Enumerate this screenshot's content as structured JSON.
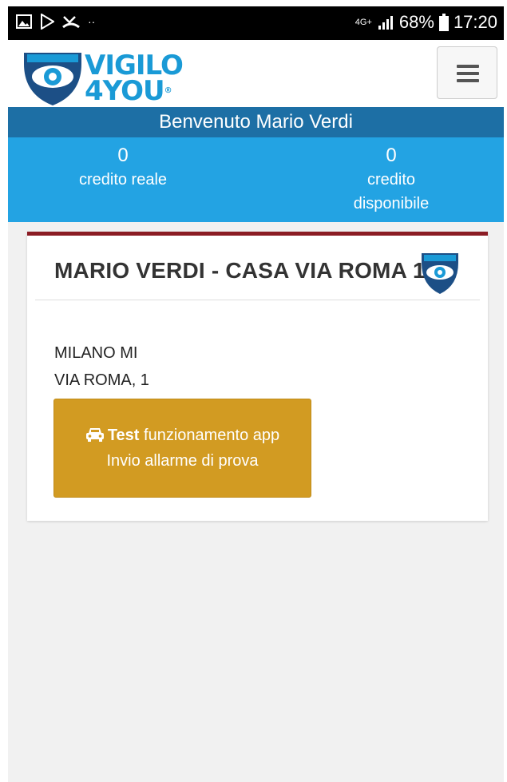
{
  "status_bar": {
    "network": "4G+",
    "battery": "68%",
    "time": "17:20"
  },
  "header": {
    "logo_line1": "VIGILO",
    "logo_line2": "4YOU",
    "logo_registered": "®",
    "menu_icon": "hamburger-icon"
  },
  "welcome": {
    "text": "Benvenuto Mario Verdi"
  },
  "credits": {
    "real": {
      "value": "0",
      "label": "credito reale"
    },
    "available": {
      "value": "0",
      "label_line1": "credito",
      "label_line2": "disponibile"
    }
  },
  "card": {
    "title": "MARIO VERDI - CASA VIA ROMA 1",
    "city": "MILANO MI",
    "street": "VIA ROMA, 1",
    "test_button": {
      "icon": "car-icon",
      "bold": "Test",
      "text": " funzionamento app",
      "subtext": "Invio allarme di prova"
    }
  },
  "colors": {
    "brand_blue": "#1a9ad6",
    "welcome_bar": "#1d6fa5",
    "credits_bar": "#23a3e3",
    "card_accent": "#8b1c24",
    "test_button": "#d29b22"
  }
}
